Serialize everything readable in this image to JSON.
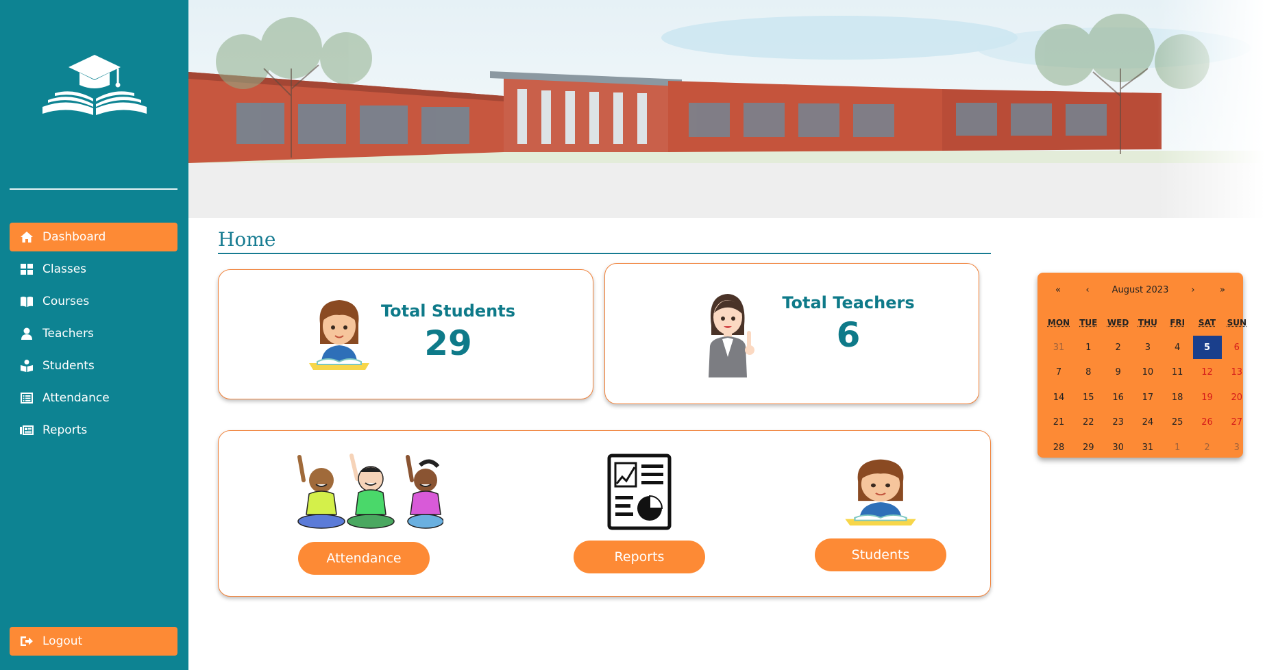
{
  "sidebar": {
    "items": [
      {
        "label": "Dashboard",
        "icon": "home-icon",
        "active": true
      },
      {
        "label": "Classes",
        "icon": "grid-icon",
        "active": false
      },
      {
        "label": "Courses",
        "icon": "book-icon",
        "active": false
      },
      {
        "label": "Teachers",
        "icon": "user-icon",
        "active": false
      },
      {
        "label": "Students",
        "icon": "student-icon",
        "active": false
      },
      {
        "label": "Attendance",
        "icon": "list-icon",
        "active": false
      },
      {
        "label": "Reports",
        "icon": "newspaper-icon",
        "active": false
      }
    ],
    "logout_label": "Logout"
  },
  "page": {
    "title": "Home"
  },
  "stats": {
    "students": {
      "label": "Total Students",
      "value": "29"
    },
    "teachers": {
      "label": "Total Teachers",
      "value": "6"
    }
  },
  "shortcuts": {
    "attendance": "Attendance",
    "reports": "Reports",
    "students": "Students"
  },
  "calendar": {
    "nav": {
      "prev_year": "«",
      "prev_month": "‹",
      "next_month": "›",
      "next_year": "»"
    },
    "month_label": "August 2023",
    "weekdays": [
      "MON",
      "TUE",
      "WED",
      "THU",
      "FRI",
      "SAT",
      "SUN"
    ],
    "weeks": [
      [
        "31",
        "1",
        "2",
        "3",
        "4",
        "5",
        "6"
      ],
      [
        "7",
        "8",
        "9",
        "10",
        "11",
        "12",
        "13"
      ],
      [
        "14",
        "15",
        "16",
        "17",
        "18",
        "19",
        "20"
      ],
      [
        "21",
        "22",
        "23",
        "24",
        "25",
        "26",
        "27"
      ],
      [
        "28",
        "29",
        "30",
        "31",
        "1",
        "2",
        "3"
      ]
    ],
    "today": "5"
  },
  "colors": {
    "sidebar": "#0d8392",
    "accent": "#fd8a35",
    "text_teal": "#0e7a89",
    "today": "#1a3f8c",
    "weekend": "#d41a1a"
  }
}
